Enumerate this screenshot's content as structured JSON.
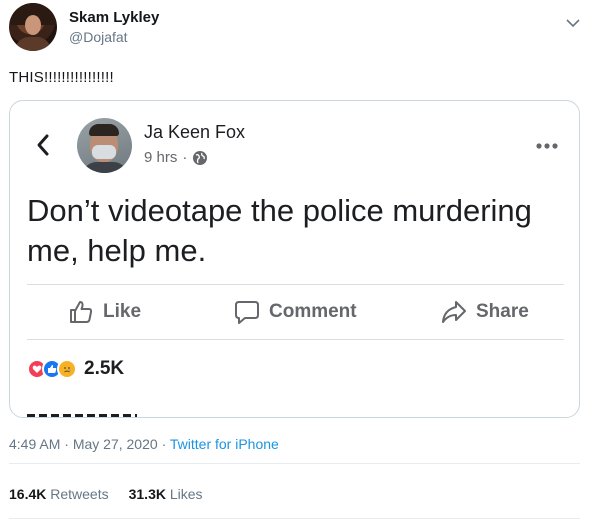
{
  "tweet": {
    "author_name": "Skam Lykley",
    "author_handle": "@Dojafat",
    "text": "THIS!!!!!!!!!!!!!!!!",
    "time": "4:49 AM",
    "date": "May 27, 2020",
    "source": "Twitter for iPhone",
    "retweets_count": "16.4K",
    "retweets_label": "Retweets",
    "likes_count": "31.3K",
    "likes_label": "Likes"
  },
  "fb_post": {
    "author": "Ja Keen Fox",
    "time_ago": "9 hrs",
    "separator": "·",
    "body": "Don’t videotape the police murdering me, help me.",
    "actions": {
      "like": "Like",
      "comment": "Comment",
      "share": "Share"
    },
    "reaction_count": "2.5K",
    "reactions": [
      "love",
      "like",
      "sad"
    ]
  },
  "icons": {
    "menu": "chevron-down-icon",
    "back": "back-arrow-icon",
    "privacy": "globe-icon",
    "more": "more-horizontal-icon"
  },
  "colors": {
    "twitter_link": "#1b95e0",
    "fb_love": "#f33e58",
    "fb_like": "#1877f2",
    "fb_sad": "#f7b125"
  }
}
